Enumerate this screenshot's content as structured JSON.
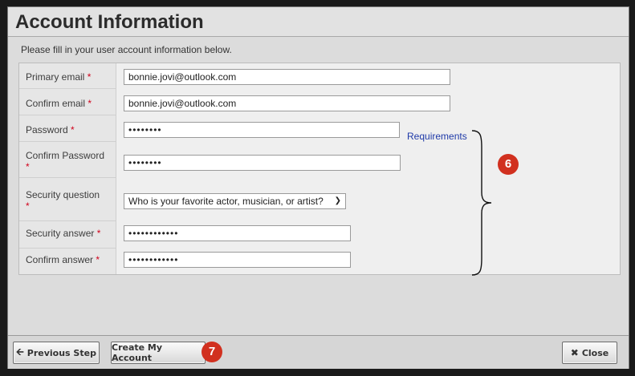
{
  "dialog": {
    "title": "Account Information",
    "instructions": "Please fill in your user account information below."
  },
  "form": {
    "required_marker": "*",
    "primary_email": {
      "label": "Primary email",
      "value": "bonnie.jovi@outlook.com"
    },
    "confirm_email": {
      "label": "Confirm email",
      "value": "bonnie.jovi@outlook.com"
    },
    "password": {
      "label": "Password",
      "value": "••••••••"
    },
    "requirements_link": "Requirements",
    "confirm_password": {
      "label": "Confirm Password",
      "value": "••••••••"
    },
    "security_question": {
      "label": "Security question",
      "selected": "Who is your favorite actor, musician, or artist?"
    },
    "security_answer": {
      "label": "Security answer",
      "value": "••••••••••••"
    },
    "confirm_answer": {
      "label": "Confirm answer",
      "value": "••••••••••••"
    }
  },
  "callouts": {
    "fields": "6",
    "create": "7"
  },
  "footer": {
    "previous_label": "Previous Step",
    "create_label": "Create My Account",
    "close_label": "Close"
  },
  "icons": {
    "previous": "arrow-left-icon",
    "close": "x-close-icon",
    "question_select": "chevron-down-icon"
  },
  "colors": {
    "required": "#d0021b",
    "link": "#1f3aa8",
    "callout": "#d1301f"
  }
}
